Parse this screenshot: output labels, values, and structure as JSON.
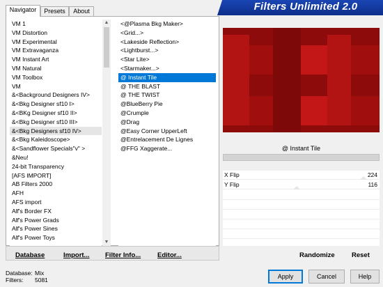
{
  "tabs": [
    "Navigator",
    "Presets",
    "About"
  ],
  "app_title": "Filters Unlimited 2.0",
  "categories": [
    "VM 1",
    "VM Distortion",
    "VM Experimental",
    "VM Extravaganza",
    "VM Instant Art",
    "VM Natural",
    "VM Toolbox",
    "VM",
    "&<Background Designers IV>",
    "&<Bkg Designer sf10 I>",
    "&<BKg Designer sf10 II>",
    "&<Bkg Designer sf10 III>",
    "&<Bkg Designers sf10 IV>",
    "&<Bkg Kaleidoscope>",
    "&<Sandflower Specials\"v\" >",
    "&Neu!",
    "24-bit Transparency",
    "[AFS IMPORT]",
    "AB Filters 2000",
    "AFH",
    "AFS import",
    "Alf's Border FX",
    "Alf's Power Grads",
    "Alf's Power Sines",
    "Alf's Power Toys"
  ],
  "filters": [
    "<@Plasma Bkg Maker>",
    "<Grid...>",
    "<Lakeside Reflection>",
    "<Lightburst...>",
    "<Star Lite>",
    "<Starmaker...>",
    "@ Instant Tile",
    "@ THE BLAST",
    "@ THE TWIST",
    "@BlueBerry Pie",
    "@Crumple",
    "@Drag",
    "@Easy Corner UpperLeft",
    "@Entrelacement De Lignes",
    "@FFG Xaggerate..."
  ],
  "selected_category_index": 12,
  "selected_filter_index": 6,
  "left_buttons": {
    "database": "Database",
    "import": "Import...",
    "filter_info": "Filter Info...",
    "editor": "Editor..."
  },
  "selected_filter_name": "@ Instant Tile",
  "params": [
    {
      "label": "X Flip",
      "value": "224"
    },
    {
      "label": "Y Flip",
      "value": "116"
    }
  ],
  "right_buttons": {
    "randomize": "Randomize",
    "reset": "Reset"
  },
  "status": {
    "database_label": "Database:",
    "database_value": "Mix",
    "filters_label": "Filters:",
    "filters_value": "5081"
  },
  "dialog_buttons": {
    "apply": "Apply",
    "cancel": "Cancel",
    "help": "Help"
  },
  "colors": {
    "preview_dark": "#8e0b0b",
    "preview_light": "#b01212",
    "selection": "#0078d7",
    "banner": "#1a46b4"
  }
}
